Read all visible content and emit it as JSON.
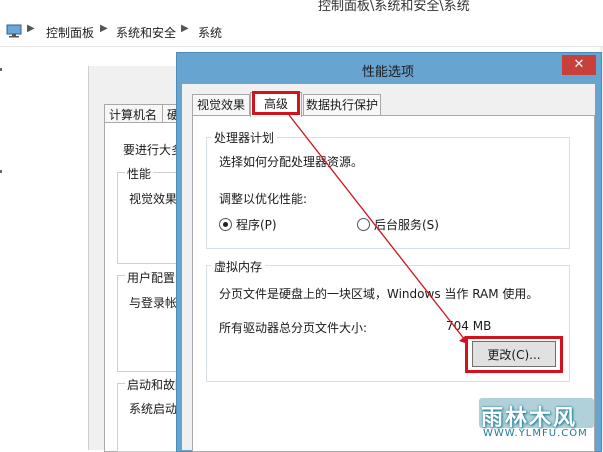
{
  "background_window": {
    "title": "控制面板\\系统和安全\\系统",
    "breadcrumb": [
      "控制面板",
      "系统和安全",
      "系统"
    ]
  },
  "system_dialog": {
    "tabs": [
      "计算机名",
      "硬"
    ],
    "intro": "要进行大多",
    "performance_legend": "性能",
    "performance_text": "视觉效果",
    "user_profile_legend": "用户配置",
    "user_profile_text": "与登录帐",
    "startup_legend": "启动和故障",
    "startup_text": "系统启动"
  },
  "dialog": {
    "title": "性能选项",
    "close_glyph": "✕",
    "tabs": [
      "视觉效果",
      "高级",
      "数据执行保护"
    ],
    "active_tab": "高级",
    "processor": {
      "legend": "处理器计划",
      "description": "选择如何分配处理器资源。",
      "adjust_label": "调整以优化性能:",
      "option_programs": "程序(P)",
      "option_background": "后台服务(S)",
      "selected": "程序(P)"
    },
    "virtual_memory": {
      "legend": "虚拟内存",
      "description": "分页文件是硬盘上的一块区域，Windows 当作 RAM 使用。",
      "total_label": "所有驱动器总分页文件大小:",
      "total_value": "704 MB",
      "change_button": "更改(C)..."
    }
  },
  "annotation": {
    "color": "#d0131c"
  },
  "watermark": {
    "logo": "雨林木风",
    "url": "WWW.YLMFU.COM"
  }
}
